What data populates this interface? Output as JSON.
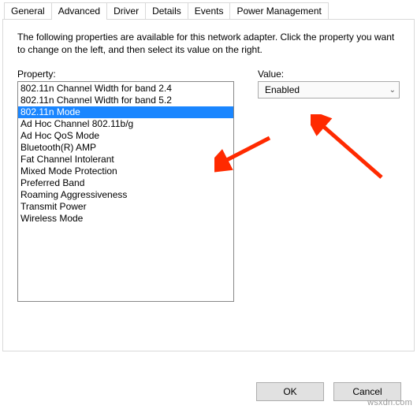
{
  "tabs": {
    "general": "General",
    "advanced": "Advanced",
    "driver": "Driver",
    "details": "Details",
    "events": "Events",
    "power": "Power Management"
  },
  "description": "The following properties are available for this network adapter. Click the property you want to change on the left, and then select its value on the right.",
  "labels": {
    "property": "Property:",
    "value": "Value:"
  },
  "properties": [
    "802.11n Channel Width for band 2.4",
    "802.11n Channel Width for band 5.2",
    "802.11n Mode",
    "Ad Hoc Channel 802.11b/g",
    "Ad Hoc QoS Mode",
    "Bluetooth(R) AMP",
    "Fat Channel Intolerant",
    "Mixed Mode Protection",
    "Preferred Band",
    "Roaming Aggressiveness",
    "Transmit Power",
    "Wireless Mode"
  ],
  "selected_property_index": 2,
  "value_selected": "Enabled",
  "buttons": {
    "ok": "OK",
    "cancel": "Cancel"
  },
  "watermark": "wsxdn.com"
}
